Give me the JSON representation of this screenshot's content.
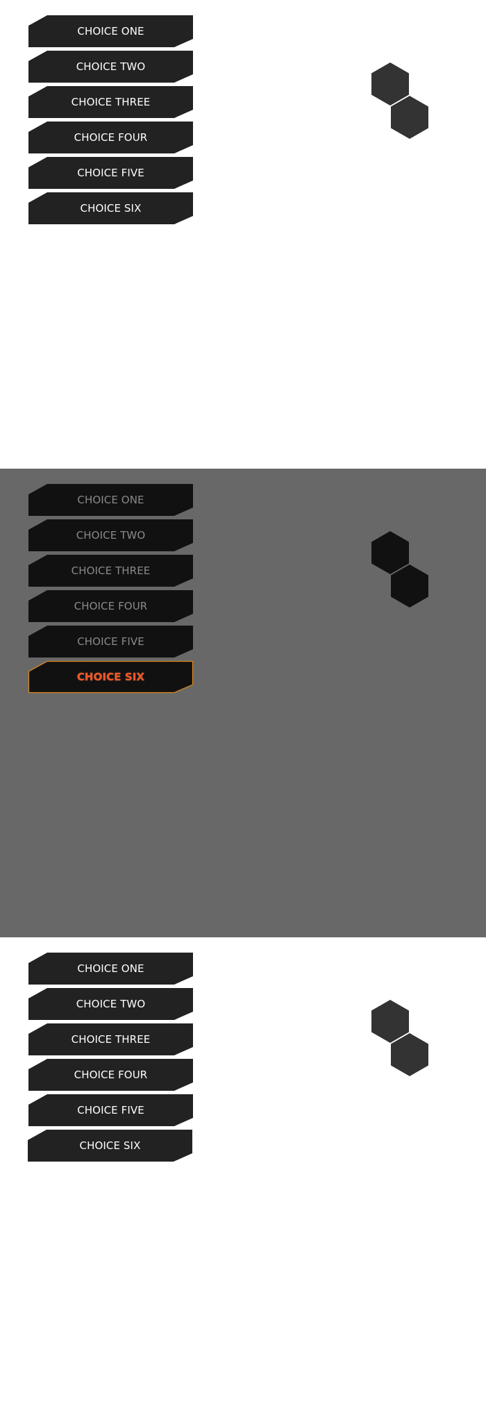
{
  "colors": {
    "light_background": "#ffffff",
    "overlay_background": "#686868",
    "button_fill_normal": "#222222",
    "button_fill_dimmed": "#111111",
    "label_normal": "#ffffff",
    "label_dimmed": "#8a8a8a",
    "highlight_border": "#e08a1e",
    "highlight_label": "#f0552b",
    "hex_normal": "#333333",
    "hex_dimmed": "#111111"
  },
  "panels": [
    {
      "state": "default",
      "items": [
        {
          "label": "CHOICE ONE"
        },
        {
          "label": "CHOICE TWO"
        },
        {
          "label": "CHOICE THREE"
        },
        {
          "label": "CHOICE FOUR"
        },
        {
          "label": "CHOICE FIVE"
        },
        {
          "label": "CHOICE SIX"
        }
      ]
    },
    {
      "state": "focused-choice-six",
      "items": [
        {
          "label": "CHOICE ONE"
        },
        {
          "label": "CHOICE TWO"
        },
        {
          "label": "CHOICE THREE"
        },
        {
          "label": "CHOICE FOUR"
        },
        {
          "label": "CHOICE FIVE"
        },
        {
          "label": "CHOICE SIX"
        }
      ]
    },
    {
      "state": "pressed-choice-six",
      "items": [
        {
          "label": "CHOICE ONE"
        },
        {
          "label": "CHOICE TWO"
        },
        {
          "label": "CHOICE THREE"
        },
        {
          "label": "CHOICE FOUR"
        },
        {
          "label": "CHOICE FIVE"
        },
        {
          "label": "CHOICE SIX"
        }
      ]
    }
  ]
}
